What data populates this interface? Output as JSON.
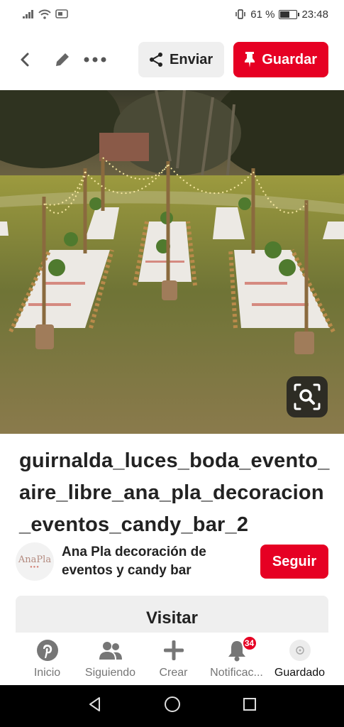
{
  "status_bar": {
    "battery_text": "61 %",
    "battery_level": 0.61,
    "time": "23:48"
  },
  "top_bar": {
    "share_label": "Enviar",
    "save_label": "Guardar"
  },
  "pin": {
    "title": "guirnalda_luces_boda_evento_aire_libre_ana_pla_decoracion_eventos_candy_bar_2"
  },
  "creator": {
    "avatar_name": "AnaPla",
    "avatar_dots": "●●●",
    "name": "Ana Pla decoración de eventos y candy bar",
    "follow_label": "Seguir"
  },
  "visit_label": "Visitar",
  "bottom_nav": {
    "items": [
      {
        "label": "Inicio",
        "icon": "pinterest-icon"
      },
      {
        "label": "Siguiendo",
        "icon": "people-icon"
      },
      {
        "label": "Crear",
        "icon": "plus-icon"
      },
      {
        "label": "Notificac...",
        "icon": "bell-icon",
        "badge": "34"
      },
      {
        "label": "Guardado",
        "icon": "profile-icon"
      }
    ]
  },
  "colors": {
    "brand_red": "#e60023",
    "button_gray": "#efefef"
  }
}
